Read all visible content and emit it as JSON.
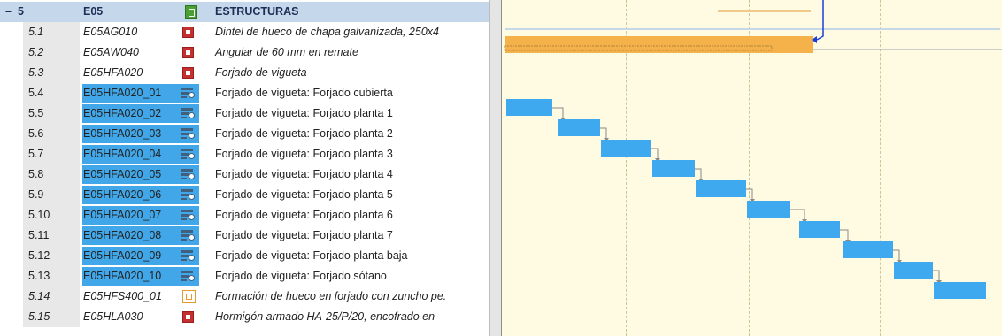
{
  "colors": {
    "header_band": "#c5d7ea",
    "code_highlight": "#42a7e8",
    "summary_bar": "#f5b24a",
    "task_bar": "#3fa9ef",
    "link_line": "#8a8a8a",
    "milestone_link": "#1a3fd8",
    "weekend_band": "#fffbe2"
  },
  "grid": {
    "header": {
      "toggle": "–",
      "num": "5",
      "code": "E05",
      "icon": "chapter-icon",
      "desc": "ESTRUCTURAS"
    },
    "rows": [
      {
        "num": "5.1",
        "code": "E05AG010",
        "icon": "red-item-icon",
        "desc": "Dintel de hueco de chapa galvanizada, 250x4",
        "italic": true,
        "highlight": false
      },
      {
        "num": "5.2",
        "code": "E05AW040",
        "icon": "red-item-icon",
        "desc": "Angular de 60 mm en remate",
        "italic": true,
        "highlight": false
      },
      {
        "num": "5.3",
        "code": "E05HFA020",
        "icon": "red-item-icon",
        "desc": "Forjado de vigueta",
        "italic": true,
        "highlight": false
      },
      {
        "num": "5.4",
        "code": "E05HFA020_01",
        "icon": "task-icon",
        "desc": "Forjado de vigueta: Forjado cubierta",
        "italic": false,
        "highlight": true
      },
      {
        "num": "5.5",
        "code": "E05HFA020_02",
        "icon": "task-icon",
        "desc": "Forjado de vigueta: Forjado planta 1",
        "italic": false,
        "highlight": true
      },
      {
        "num": "5.6",
        "code": "E05HFA020_03",
        "icon": "task-icon",
        "desc": "Forjado de vigueta: Forjado planta 2",
        "italic": false,
        "highlight": true
      },
      {
        "num": "5.7",
        "code": "E05HFA020_04",
        "icon": "task-icon",
        "desc": "Forjado de vigueta: Forjado planta 3",
        "italic": false,
        "highlight": true
      },
      {
        "num": "5.8",
        "code": "E05HFA020_05",
        "icon": "task-icon",
        "desc": "Forjado de vigueta: Forjado planta 4",
        "italic": false,
        "highlight": true
      },
      {
        "num": "5.9",
        "code": "E05HFA020_06",
        "icon": "task-icon",
        "desc": "Forjado de vigueta: Forjado planta 5",
        "italic": false,
        "highlight": true
      },
      {
        "num": "5.10",
        "code": "E05HFA020_07",
        "icon": "task-icon",
        "desc": "Forjado de vigueta: Forjado planta 6",
        "italic": false,
        "highlight": true
      },
      {
        "num": "5.11",
        "code": "E05HFA020_08",
        "icon": "task-icon",
        "desc": "Forjado de vigueta: Forjado planta 7",
        "italic": false,
        "highlight": true
      },
      {
        "num": "5.12",
        "code": "E05HFA020_09",
        "icon": "task-icon",
        "desc": "Forjado de vigueta: Forjado planta baja",
        "italic": false,
        "highlight": true
      },
      {
        "num": "5.13",
        "code": "E05HFA020_10",
        "icon": "task-icon",
        "desc": "Forjado de vigueta: Forjado sótano",
        "italic": false,
        "highlight": true
      },
      {
        "num": "5.14",
        "code": "E05HFS400_01",
        "icon": "orange-item-icon",
        "desc": "Formación de hueco en forjado con zuncho pe.",
        "italic": true,
        "highlight": false
      },
      {
        "num": "5.15",
        "code": "E05HLA030",
        "icon": "red-item-icon",
        "desc": "Hormigón armado HA-25/P/20, encofrado en",
        "italic": true,
        "highlight": false
      }
    ]
  }
}
